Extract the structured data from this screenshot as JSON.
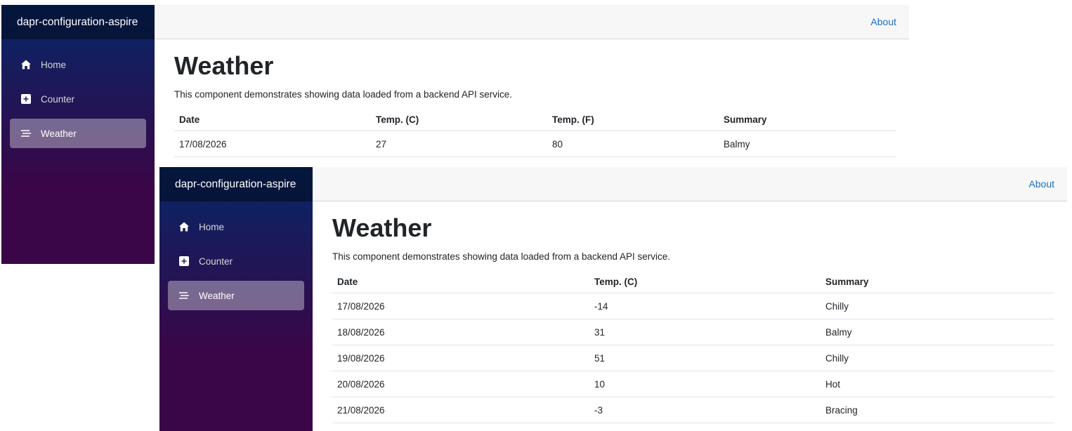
{
  "windows": [
    {
      "brand": "dapr-configuration-aspire",
      "nav": [
        {
          "label": "Home",
          "icon": "home-icon"
        },
        {
          "label": "Counter",
          "icon": "plus-square-icon"
        },
        {
          "label": "Weather",
          "icon": "list-icon",
          "active": true
        }
      ],
      "top_link": "About",
      "title": "Weather",
      "description": "This component demonstrates showing data loaded from a backend API service.",
      "columns": [
        "Date",
        "Temp. (C)",
        "Temp. (F)",
        "Summary"
      ],
      "rows": [
        [
          "17/08/2026",
          "27",
          "80",
          "Balmy"
        ]
      ]
    },
    {
      "brand": "dapr-configuration-aspire",
      "nav": [
        {
          "label": "Home",
          "icon": "home-icon"
        },
        {
          "label": "Counter",
          "icon": "plus-square-icon"
        },
        {
          "label": "Weather",
          "icon": "list-icon",
          "active": true
        }
      ],
      "top_link": "About",
      "title": "Weather",
      "description": "This component demonstrates showing data loaded from a backend API service.",
      "columns": [
        "Date",
        "Temp. (C)",
        "Summary"
      ],
      "rows": [
        [
          "17/08/2026",
          "-14",
          "Chilly"
        ],
        [
          "18/08/2026",
          "31",
          "Balmy"
        ],
        [
          "19/08/2026",
          "51",
          "Chilly"
        ],
        [
          "20/08/2026",
          "10",
          "Hot"
        ],
        [
          "21/08/2026",
          "-3",
          "Bracing"
        ]
      ]
    }
  ],
  "colors": {
    "sidebar_top": "#052767",
    "sidebar_bottom": "#3a0647",
    "link": "#1b6ec2",
    "topbar": "#f7f7f7"
  }
}
